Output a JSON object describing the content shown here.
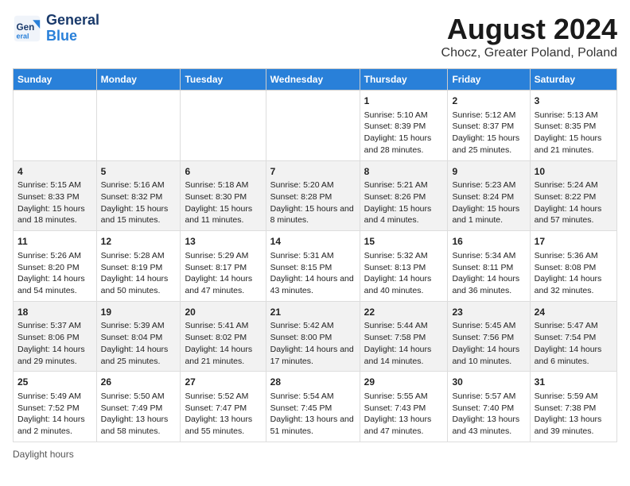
{
  "logo": {
    "line1": "General",
    "line2": "Blue"
  },
  "title": "August 2024",
  "subtitle": "Chocz, Greater Poland, Poland",
  "days_of_week": [
    "Sunday",
    "Monday",
    "Tuesday",
    "Wednesday",
    "Thursday",
    "Friday",
    "Saturday"
  ],
  "footer": "Daylight hours",
  "weeks": [
    [
      {
        "day": "",
        "sunrise": "",
        "sunset": "",
        "daylight": ""
      },
      {
        "day": "",
        "sunrise": "",
        "sunset": "",
        "daylight": ""
      },
      {
        "day": "",
        "sunrise": "",
        "sunset": "",
        "daylight": ""
      },
      {
        "day": "",
        "sunrise": "",
        "sunset": "",
        "daylight": ""
      },
      {
        "day": "1",
        "sunrise": "Sunrise: 5:10 AM",
        "sunset": "Sunset: 8:39 PM",
        "daylight": "Daylight: 15 hours and 28 minutes."
      },
      {
        "day": "2",
        "sunrise": "Sunrise: 5:12 AM",
        "sunset": "Sunset: 8:37 PM",
        "daylight": "Daylight: 15 hours and 25 minutes."
      },
      {
        "day": "3",
        "sunrise": "Sunrise: 5:13 AM",
        "sunset": "Sunset: 8:35 PM",
        "daylight": "Daylight: 15 hours and 21 minutes."
      }
    ],
    [
      {
        "day": "4",
        "sunrise": "Sunrise: 5:15 AM",
        "sunset": "Sunset: 8:33 PM",
        "daylight": "Daylight: 15 hours and 18 minutes."
      },
      {
        "day": "5",
        "sunrise": "Sunrise: 5:16 AM",
        "sunset": "Sunset: 8:32 PM",
        "daylight": "Daylight: 15 hours and 15 minutes."
      },
      {
        "day": "6",
        "sunrise": "Sunrise: 5:18 AM",
        "sunset": "Sunset: 8:30 PM",
        "daylight": "Daylight: 15 hours and 11 minutes."
      },
      {
        "day": "7",
        "sunrise": "Sunrise: 5:20 AM",
        "sunset": "Sunset: 8:28 PM",
        "daylight": "Daylight: 15 hours and 8 minutes."
      },
      {
        "day": "8",
        "sunrise": "Sunrise: 5:21 AM",
        "sunset": "Sunset: 8:26 PM",
        "daylight": "Daylight: 15 hours and 4 minutes."
      },
      {
        "day": "9",
        "sunrise": "Sunrise: 5:23 AM",
        "sunset": "Sunset: 8:24 PM",
        "daylight": "Daylight: 15 hours and 1 minute."
      },
      {
        "day": "10",
        "sunrise": "Sunrise: 5:24 AM",
        "sunset": "Sunset: 8:22 PM",
        "daylight": "Daylight: 14 hours and 57 minutes."
      }
    ],
    [
      {
        "day": "11",
        "sunrise": "Sunrise: 5:26 AM",
        "sunset": "Sunset: 8:20 PM",
        "daylight": "Daylight: 14 hours and 54 minutes."
      },
      {
        "day": "12",
        "sunrise": "Sunrise: 5:28 AM",
        "sunset": "Sunset: 8:19 PM",
        "daylight": "Daylight: 14 hours and 50 minutes."
      },
      {
        "day": "13",
        "sunrise": "Sunrise: 5:29 AM",
        "sunset": "Sunset: 8:17 PM",
        "daylight": "Daylight: 14 hours and 47 minutes."
      },
      {
        "day": "14",
        "sunrise": "Sunrise: 5:31 AM",
        "sunset": "Sunset: 8:15 PM",
        "daylight": "Daylight: 14 hours and 43 minutes."
      },
      {
        "day": "15",
        "sunrise": "Sunrise: 5:32 AM",
        "sunset": "Sunset: 8:13 PM",
        "daylight": "Daylight: 14 hours and 40 minutes."
      },
      {
        "day": "16",
        "sunrise": "Sunrise: 5:34 AM",
        "sunset": "Sunset: 8:11 PM",
        "daylight": "Daylight: 14 hours and 36 minutes."
      },
      {
        "day": "17",
        "sunrise": "Sunrise: 5:36 AM",
        "sunset": "Sunset: 8:08 PM",
        "daylight": "Daylight: 14 hours and 32 minutes."
      }
    ],
    [
      {
        "day": "18",
        "sunrise": "Sunrise: 5:37 AM",
        "sunset": "Sunset: 8:06 PM",
        "daylight": "Daylight: 14 hours and 29 minutes."
      },
      {
        "day": "19",
        "sunrise": "Sunrise: 5:39 AM",
        "sunset": "Sunset: 8:04 PM",
        "daylight": "Daylight: 14 hours and 25 minutes."
      },
      {
        "day": "20",
        "sunrise": "Sunrise: 5:41 AM",
        "sunset": "Sunset: 8:02 PM",
        "daylight": "Daylight: 14 hours and 21 minutes."
      },
      {
        "day": "21",
        "sunrise": "Sunrise: 5:42 AM",
        "sunset": "Sunset: 8:00 PM",
        "daylight": "Daylight: 14 hours and 17 minutes."
      },
      {
        "day": "22",
        "sunrise": "Sunrise: 5:44 AM",
        "sunset": "Sunset: 7:58 PM",
        "daylight": "Daylight: 14 hours and 14 minutes."
      },
      {
        "day": "23",
        "sunrise": "Sunrise: 5:45 AM",
        "sunset": "Sunset: 7:56 PM",
        "daylight": "Daylight: 14 hours and 10 minutes."
      },
      {
        "day": "24",
        "sunrise": "Sunrise: 5:47 AM",
        "sunset": "Sunset: 7:54 PM",
        "daylight": "Daylight: 14 hours and 6 minutes."
      }
    ],
    [
      {
        "day": "25",
        "sunrise": "Sunrise: 5:49 AM",
        "sunset": "Sunset: 7:52 PM",
        "daylight": "Daylight: 14 hours and 2 minutes."
      },
      {
        "day": "26",
        "sunrise": "Sunrise: 5:50 AM",
        "sunset": "Sunset: 7:49 PM",
        "daylight": "Daylight: 13 hours and 58 minutes."
      },
      {
        "day": "27",
        "sunrise": "Sunrise: 5:52 AM",
        "sunset": "Sunset: 7:47 PM",
        "daylight": "Daylight: 13 hours and 55 minutes."
      },
      {
        "day": "28",
        "sunrise": "Sunrise: 5:54 AM",
        "sunset": "Sunset: 7:45 PM",
        "daylight": "Daylight: 13 hours and 51 minutes."
      },
      {
        "day": "29",
        "sunrise": "Sunrise: 5:55 AM",
        "sunset": "Sunset: 7:43 PM",
        "daylight": "Daylight: 13 hours and 47 minutes."
      },
      {
        "day": "30",
        "sunrise": "Sunrise: 5:57 AM",
        "sunset": "Sunset: 7:40 PM",
        "daylight": "Daylight: 13 hours and 43 minutes."
      },
      {
        "day": "31",
        "sunrise": "Sunrise: 5:59 AM",
        "sunset": "Sunset: 7:38 PM",
        "daylight": "Daylight: 13 hours and 39 minutes."
      }
    ]
  ]
}
